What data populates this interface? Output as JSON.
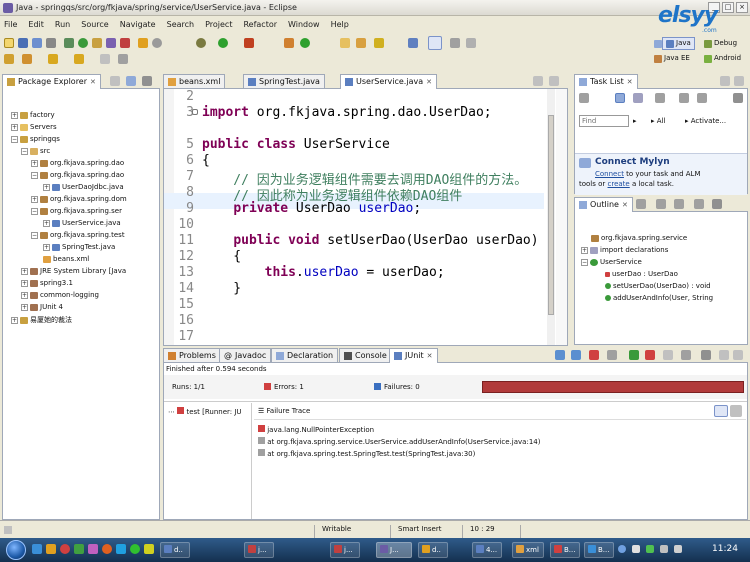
{
  "window": {
    "title": "Java - springqs/src/org/fkjava/spring/service/UserService.java - Eclipse"
  },
  "watermark": {
    "brand": "elsyy",
    "domain": ".com"
  },
  "menu": [
    "File",
    "Edit",
    "Run",
    "Source",
    "Navigate",
    "Search",
    "Project",
    "Refactor",
    "Window",
    "Help"
  ],
  "perspectives": {
    "java": "Java",
    "debug": "Debug",
    "javaee": "Java EE",
    "android": "Android"
  },
  "package_explorer": {
    "tab": "Package Explorer",
    "items": [
      "factory",
      "Servers",
      "springqs",
      "src",
      "org.fkjava.spring.dao",
      "org.fkjava.spring.dao",
      "UserDaoJdbc.java",
      "org.fkjava.spring.dom",
      "org.fkjava.spring.ser",
      "UserService.java",
      "org.fkjava.spring.test",
      "SpringTest.java",
      "beans.xml",
      "JRE System Library [Java",
      "spring3.1",
      "common-logging",
      "JUnit 4",
      "易厦她的裁法"
    ]
  },
  "editor": {
    "tabs": [
      "beans.xml",
      "SpringTest.java",
      "UserService.java"
    ],
    "line_numbers": [
      "2",
      "3",
      "5",
      "6",
      "7",
      "8",
      "9",
      "10",
      "11",
      "12",
      "13",
      "14",
      "15",
      "16",
      "17"
    ],
    "lines": {
      "l3_kw": "import",
      "l3_rest": " org.fkjava.spring.dao.UserDao;",
      "l6_kw1": "public",
      "l6_kw2": "class",
      "l6_rest": " UserService",
      "l7": "{",
      "l8": "    // 因为业务逻辑组件需要去调用DAO组件的方法。",
      "l9": "    // 因此称为业务逻辑组件依赖DAO组件",
      "l10_kw": "private",
      "l10_type": " UserDao ",
      "l10_fld": "userDao",
      "l10_end": ";",
      "l12_kw1": "public",
      "l12_kw2": "void",
      "l12_rest": " setUserDao(UserDao userDao)",
      "l13": "    {",
      "l14_kw": "this",
      "l14_dot": ".",
      "l14_fld": "userDao",
      "l14_rest": " = userDao;",
      "l15": "    }"
    }
  },
  "task_list": {
    "tab": "Task List",
    "find_placeholder": "Find",
    "all": "All",
    "activate": "Activate..."
  },
  "mylyn": {
    "title": "Connect Mylyn",
    "connect": "Connect",
    "text1": " to your task and ALM",
    "text2": "tools or ",
    "create": "create",
    "text3": " a local task."
  },
  "outline": {
    "tab": "Outline",
    "items": [
      "org.fkjava.spring.service",
      "import declarations",
      "UserService",
      "userDao : UserDao",
      "setUserDao(UserDao) : void",
      "addUserAndInfo(User, String"
    ]
  },
  "bottom_tabs": [
    "Problems",
    "Javadoc",
    "Declaration",
    "Console",
    "JUnit"
  ],
  "junit": {
    "finished": "Finished after 0.594 seconds",
    "runs_label": "Runs:",
    "runs": "1/1",
    "errors_label": "Errors:",
    "errors": "1",
    "failures_label": "Failures:",
    "failures": "0",
    "test": "test [Runner: JU",
    "failure_trace": "Failure Trace",
    "trace": [
      "java.lang.NullPointerException",
      "at org.fkjava.spring.service.UserService.addUserAndInfo(UserService.java:14)",
      "at org.fkjava.spring.test.SpringTest.test(SpringTest.java:30)"
    ]
  },
  "status": {
    "writable": "Writable",
    "insert": "Smart Insert",
    "pos": "10 : 29"
  },
  "taskbar": {
    "items": [
      "d..",
      "j...",
      "j...",
      "J...",
      "d..",
      "4...",
      "xml",
      "B...",
      "B..."
    ],
    "time": "11:24"
  }
}
